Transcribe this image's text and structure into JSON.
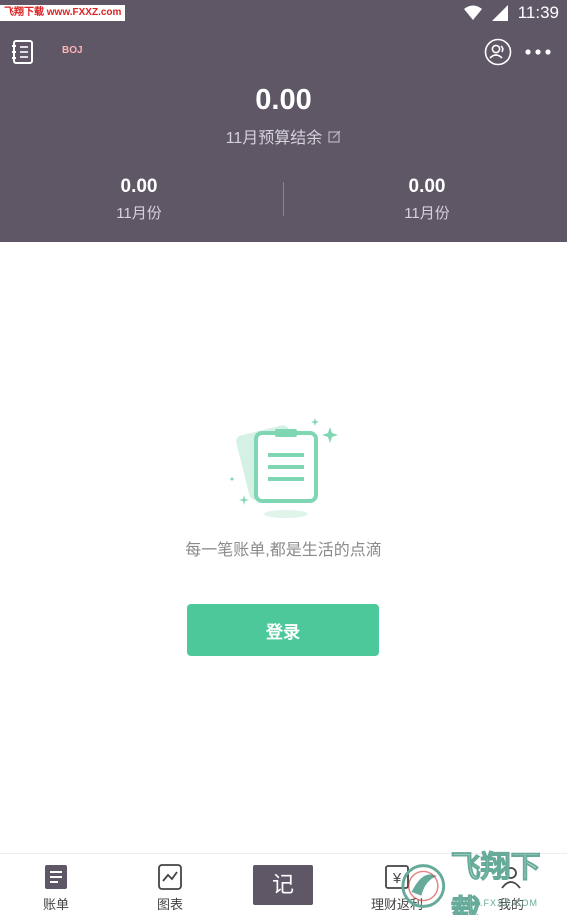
{
  "status_bar": {
    "watermark": "飞翔下载 www.FXXZ.com",
    "time": "11:39"
  },
  "header": {
    "tag": "BOJ",
    "balance": "0.00",
    "balance_label": "11月预算结余",
    "left": {
      "value": "0.00",
      "label": "11月份"
    },
    "right": {
      "value": "0.00",
      "label": "11月份"
    },
    "background_color": "#5f5666"
  },
  "empty_state": {
    "message": "每一笔账单,都是生活的点滴",
    "login_label": "登录",
    "accent_color": "#4cc89a"
  },
  "bottom_nav": {
    "items": [
      {
        "label": "账单",
        "icon": "bill-list-icon"
      },
      {
        "label": "图表",
        "icon": "chart-icon"
      },
      {
        "label": "记",
        "icon": "record-button"
      },
      {
        "label": "理财返利",
        "icon": "yen-icon"
      },
      {
        "label": "我的",
        "icon": "profile-icon"
      }
    ]
  },
  "badge": {
    "text": "飞翔下载",
    "sub": "WWW.FXXZ.COM"
  }
}
